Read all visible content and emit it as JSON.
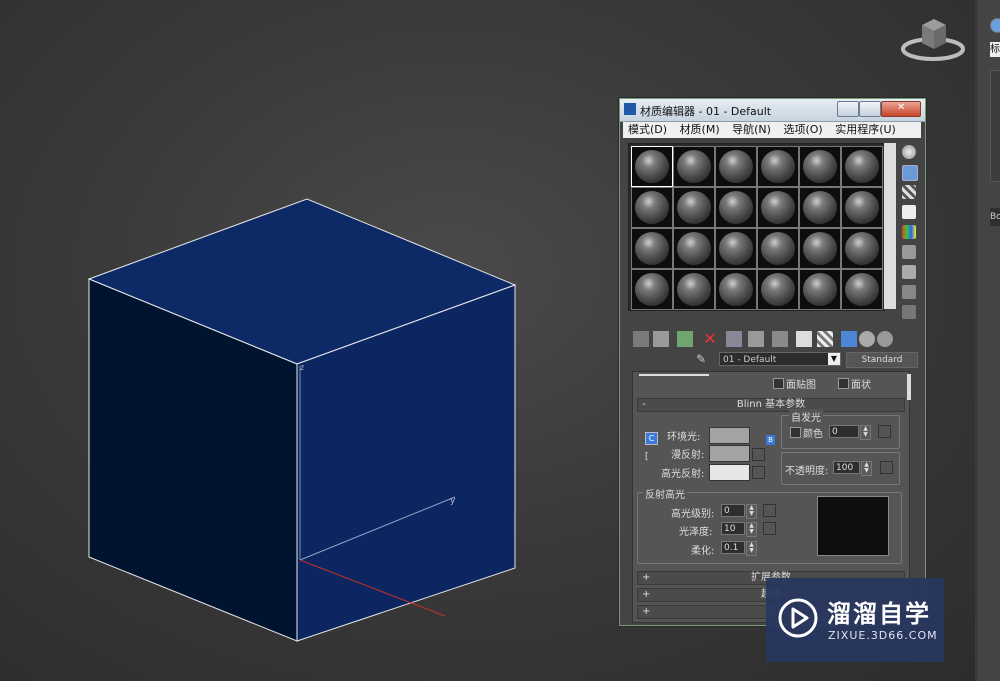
{
  "dialog": {
    "title": "材质编辑器 - 01 - Default",
    "menu": [
      "模式(D)",
      "材质(M)",
      "导航(N)",
      "选项(O)",
      "实用程序(U)"
    ],
    "material_name": "01 - Default",
    "material_type": "Standard",
    "partial_rollup": {
      "checkbox_1": "面贴图",
      "checkbox_2": "面状"
    },
    "blinn": {
      "title": "Blinn 基本参数",
      "toggle": "-",
      "self_illum_group": "自发光",
      "color_label": "颜色",
      "color_value": "0",
      "ambient_label": "环境光:",
      "diffuse_label": "漫反射:",
      "specular_label": "高光反射:",
      "opacity_label": "不透明度:",
      "opacity_value": "100",
      "lock_button": "C",
      "lock2_button": "[",
      "map_button": "B"
    },
    "highlights": {
      "group": "反射高光",
      "spec_level_label": "高光级别:",
      "spec_level_value": "0",
      "gloss_label": "光泽度:",
      "gloss_value": "10",
      "soften_label": "柔化:",
      "soften_value": "0.1"
    },
    "rollups": [
      {
        "sign": "+",
        "title": "扩展参数"
      },
      {
        "sign": "+",
        "title": "超级"
      },
      {
        "sign": "+",
        "title": "贴"
      }
    ]
  },
  "right_panel": {
    "label_1": "标",
    "label_2": "Bo"
  },
  "viewport": {
    "axis_x": "x",
    "axis_y": "y",
    "axis_z": "z"
  },
  "watermark": {
    "title": "溜溜自学",
    "url": "ZIXUE.3D66.COM"
  },
  "colors": {
    "cube_top": "#0d2a66",
    "cube_left": "#01142f",
    "cube_right": "#0b2661",
    "ambient_swatch": "#a3a3a3",
    "diffuse_swatch": "#a3a3a3",
    "specular_swatch": "#e6e6e6",
    "arrow": "#d9332a"
  }
}
